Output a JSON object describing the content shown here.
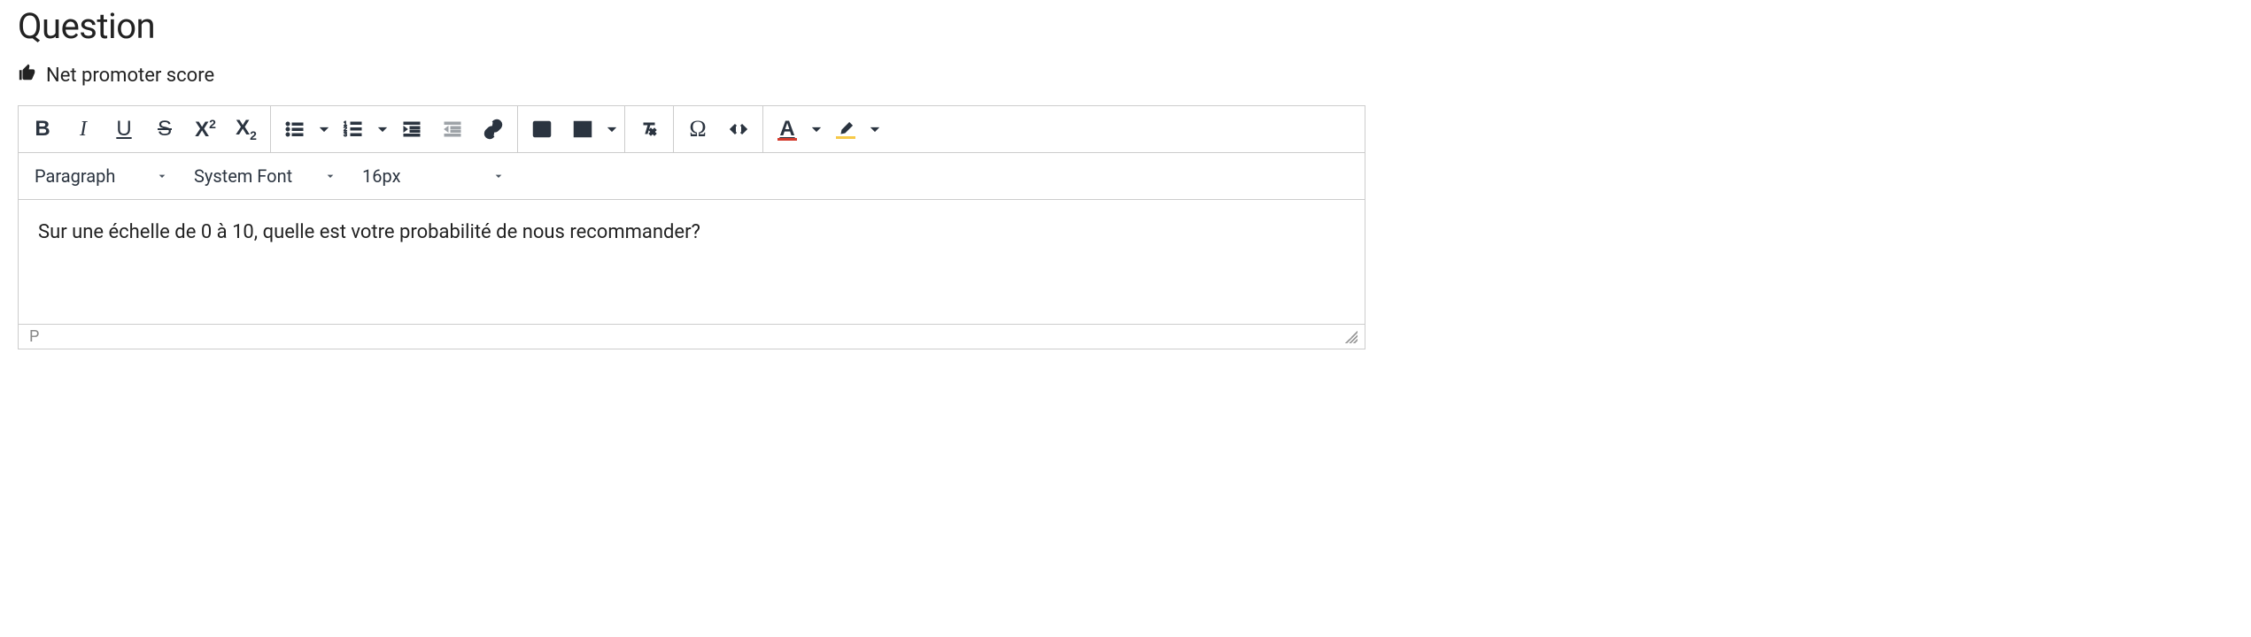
{
  "header": {
    "title": "Question",
    "subtitle": "Net promoter score"
  },
  "toolbar": {
    "selects": {
      "block_format": "Paragraph",
      "font_family": "System Font",
      "font_size": "16px"
    }
  },
  "editor": {
    "content": "Sur une échelle de 0 à 10, quelle est votre probabilité de nous recommander?"
  },
  "statusbar": {
    "path": "P"
  },
  "colors": {
    "text_color_underline": "#d33a2c",
    "highlight_underline": "#f7c948"
  }
}
